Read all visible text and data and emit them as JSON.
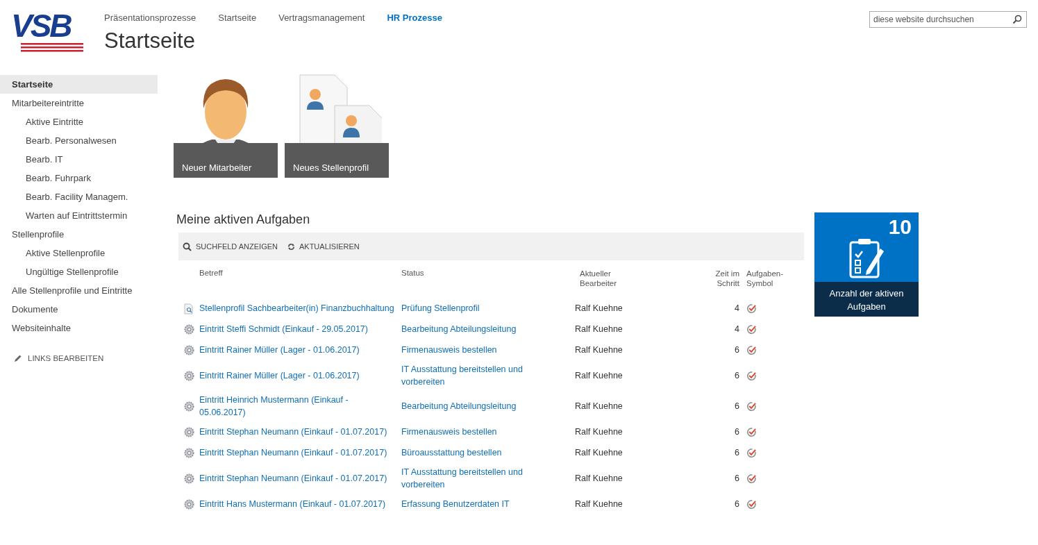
{
  "logo": {
    "text": "VSB"
  },
  "top_nav": [
    {
      "label": "Präsentationsprozesse",
      "selected": false
    },
    {
      "label": "Startseite",
      "selected": false
    },
    {
      "label": "Vertragsmanagement",
      "selected": false
    },
    {
      "label": "HR Prozesse",
      "selected": true
    }
  ],
  "page_title": "Startseite",
  "search": {
    "placeholder": "diese website durchsuchen"
  },
  "sidebar": {
    "items": [
      {
        "label": "Startseite",
        "selected": true
      },
      {
        "label": "Mitarbeitereintritte",
        "selected": false,
        "children": [
          {
            "label": "Aktive Eintritte",
            "selected": false
          },
          {
            "label": "Bearb. Personalwesen",
            "selected": false
          },
          {
            "label": "Bearb. IT",
            "selected": false
          },
          {
            "label": "Bearb. Fuhrpark",
            "selected": false
          },
          {
            "label": "Bearb. Facility Managem.",
            "selected": false
          },
          {
            "label": "Warten auf Eintrittstermin",
            "selected": false
          }
        ]
      },
      {
        "label": "Stellenprofile",
        "selected": false,
        "children": [
          {
            "label": "Aktive Stellenprofile",
            "selected": false
          },
          {
            "label": "Ungültige Stellenprofile",
            "selected": false
          }
        ]
      },
      {
        "label": "Alle Stellenprofile und Eintritte",
        "selected": false
      },
      {
        "label": "Dokumente",
        "selected": false
      },
      {
        "label": "Websiteinhalte",
        "selected": false
      }
    ],
    "edit_links": "LINKS BEARBEITEN"
  },
  "tiles": [
    {
      "kind": "person",
      "label": "Neuer Mitarbeiter"
    },
    {
      "kind": "documents",
      "label": "Neues Stellenprofil"
    }
  ],
  "tasks": {
    "title": "Meine aktiven Aufgaben",
    "toolbar": [
      {
        "kind": "search",
        "label": "SUCHFELD ANZEIGEN"
      },
      {
        "kind": "refresh",
        "label": "AKTUALISIEREN"
      }
    ],
    "columns": [
      "Betreff",
      "Status",
      "Aktueller Bearbeiter",
      "Zeit im Schritt",
      "Aufgaben-Symbol"
    ],
    "rows": [
      {
        "kind": "document",
        "subject": "Stellenprofil Sachbearbeiter(in) Finanzbuchhaltung",
        "status": "Prüfung Stellenprofil",
        "assignee": "Ralf Kuehne",
        "time": "4"
      },
      {
        "kind": "process",
        "subject": "Eintritt Steffi Schmidt (Einkauf - 29.05.2017)",
        "status": "Bearbeitung Abteilungsleitung",
        "assignee": "Ralf Kuehne",
        "time": "4"
      },
      {
        "kind": "process",
        "subject": "Eintritt Rainer Müller (Lager - 01.06.2017)",
        "status": "Firmenausweis bestellen",
        "assignee": "Ralf Kuehne",
        "time": "6"
      },
      {
        "kind": "process",
        "subject": "Eintritt Rainer Müller (Lager - 01.06.2017)",
        "status": "IT Ausstattung bereitstellen und vorbereiten",
        "assignee": "Ralf Kuehne",
        "time": "6"
      },
      {
        "kind": "process",
        "subject": "Eintritt Heinrich Mustermann (Einkauf - 05.06.2017)",
        "status": "Bearbeitung Abteilungsleitung",
        "assignee": "Ralf Kuehne",
        "time": "6"
      },
      {
        "kind": "process",
        "subject": "Eintritt Stephan Neumann (Einkauf - 01.07.2017)",
        "status": "Firmenausweis bestellen",
        "assignee": "Ralf Kuehne",
        "time": "6"
      },
      {
        "kind": "process",
        "subject": "Eintritt Stephan Neumann (Einkauf - 01.07.2017)",
        "status": "Büroausstattung bestellen",
        "assignee": "Ralf Kuehne",
        "time": "6"
      },
      {
        "kind": "process",
        "subject": "Eintritt Stephan Neumann (Einkauf - 01.07.2017)",
        "status": "IT Ausstattung bereitstellen und vorbereiten",
        "assignee": "Ralf Kuehne",
        "time": "6"
      },
      {
        "kind": "process",
        "subject": "Eintritt Hans Mustermann (Einkauf - 01.07.2017)",
        "status": "Erfassung Benutzerdaten IT",
        "assignee": "Ralf Kuehne",
        "time": "6"
      }
    ]
  },
  "counter_tile": {
    "count": "10",
    "label": "Anzahl der aktiven Aufgaben"
  }
}
